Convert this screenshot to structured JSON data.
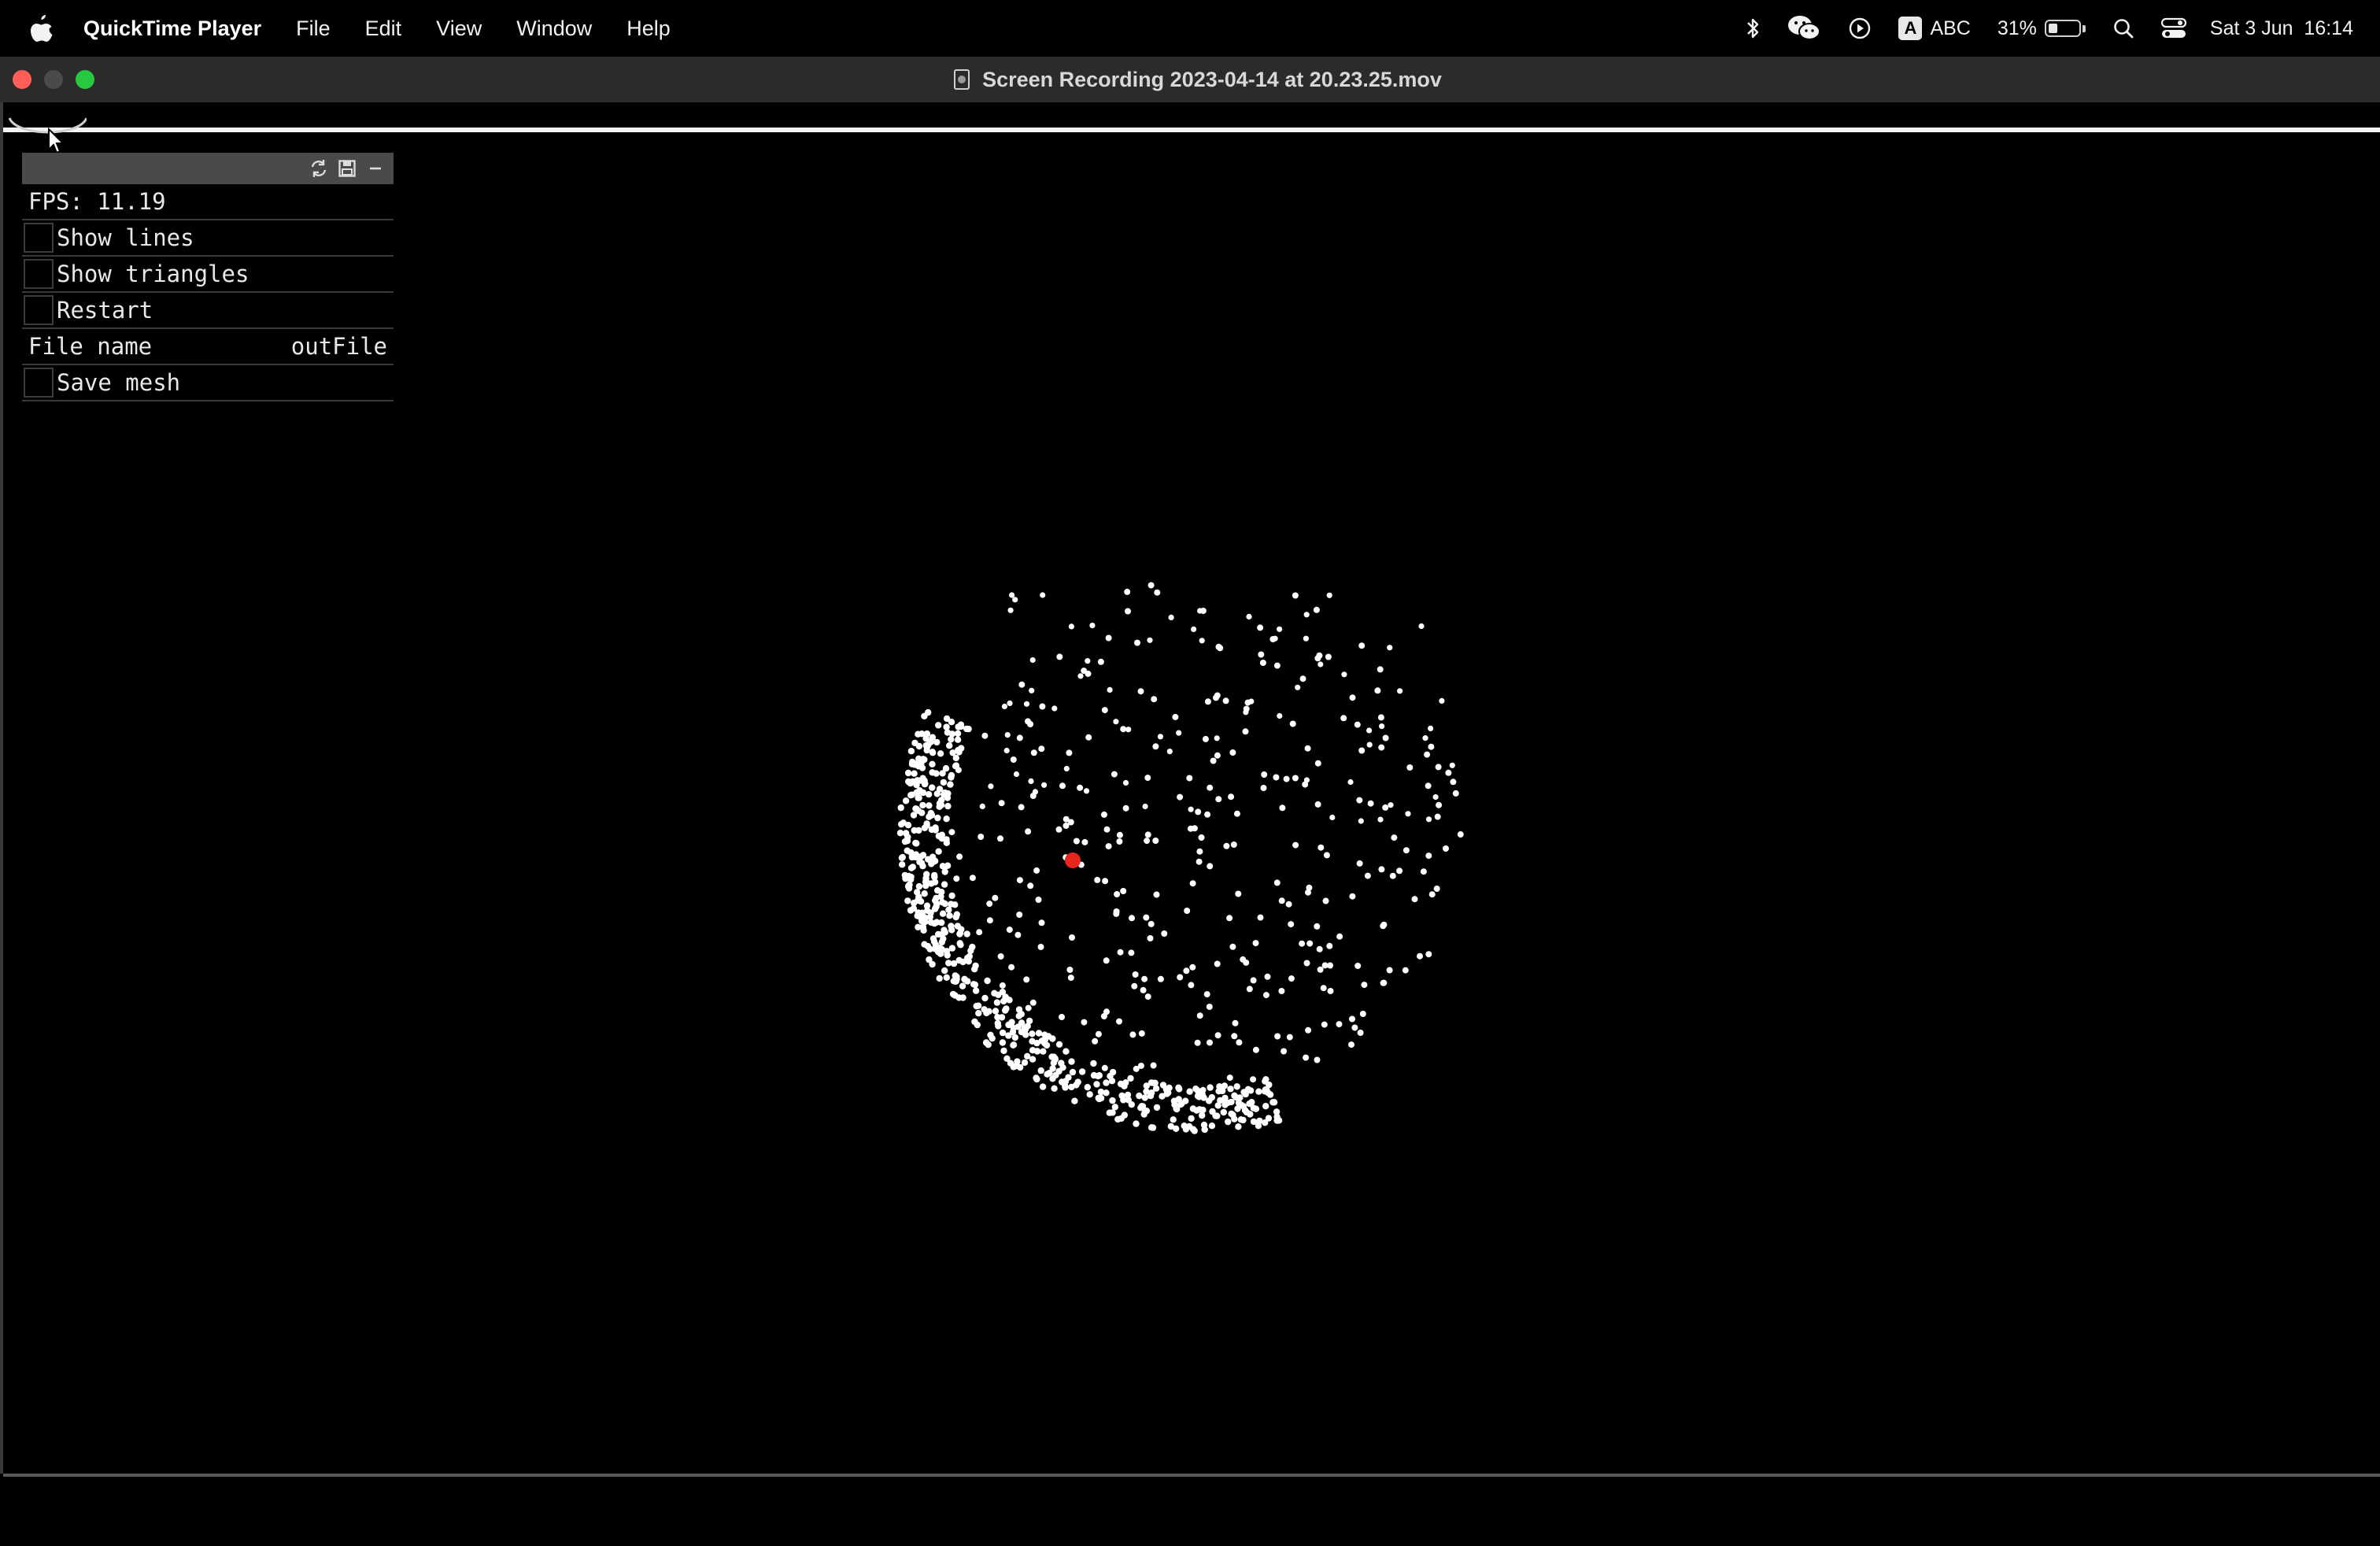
{
  "menubar": {
    "app_name": "QuickTime Player",
    "items": [
      "File",
      "Edit",
      "View",
      "Window",
      "Help"
    ],
    "status": {
      "input_source": "ABC",
      "input_badge": "A",
      "battery_percent": "31%",
      "battery_level": 0.31,
      "datetime": "Sat 3 Jun  16:14"
    }
  },
  "window": {
    "title": "Screen Recording 2023-04-14 at 20.23.25.mov"
  },
  "panel": {
    "fps": "FPS: 11.19",
    "show_lines_label": "Show lines",
    "show_triangles_label": "Show triangles",
    "restart_label": "Restart",
    "file_name_label": "File name",
    "file_name_value": "outFile",
    "save_mesh_label": "Save mesh"
  },
  "colors": {
    "point": "#ffffff",
    "highlight_point": "#e8261d",
    "close": "#ff5f57",
    "maximize": "#28c840"
  }
}
